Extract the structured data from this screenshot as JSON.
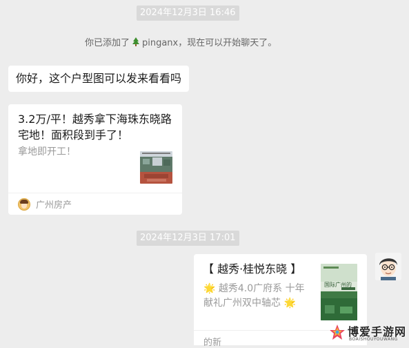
{
  "chat": {
    "timestamp_1": "2024年12月3日 16:46",
    "system_message": {
      "prefix": "你已添加了",
      "nickname_icon": "evergreen-tree-emoji",
      "nickname": " pinganx，现在可以开始聊天了。"
    },
    "message_1": "你好，这个户型图可以发来看看吗",
    "link_card_1": {
      "title": "3.2万/平！越秀拿下海珠东晓路宅地！面积段到手了！",
      "description": "拿地即开工！",
      "thumbnail_icon": "construction-site-photo",
      "source_icon": "cartoon-avatar",
      "source_name": "广州房产"
    },
    "timestamp_2": "2024年12月3日 17:01",
    "link_card_2": {
      "title": "【 越秀·桂悦东晓 】",
      "description": "🌟 越秀4.0广府系 十年献礼广州双中轴芯 🌟",
      "thumbnail_icon": "green-promo-poster",
      "thumbnail_text": "国际广州的",
      "source_name": "的新"
    },
    "self_avatar_icon": "cartoon-man-with-glasses"
  },
  "watermark": {
    "logo_icon": "star-logo",
    "name": "博爱手游网",
    "subtitle": "BOAISHOUYOUWANG"
  },
  "colors": {
    "background": "#ededed",
    "bubble": "#ffffff",
    "timestamp_bg": "#d9d9d9",
    "muted_text": "#9a9a9a"
  }
}
